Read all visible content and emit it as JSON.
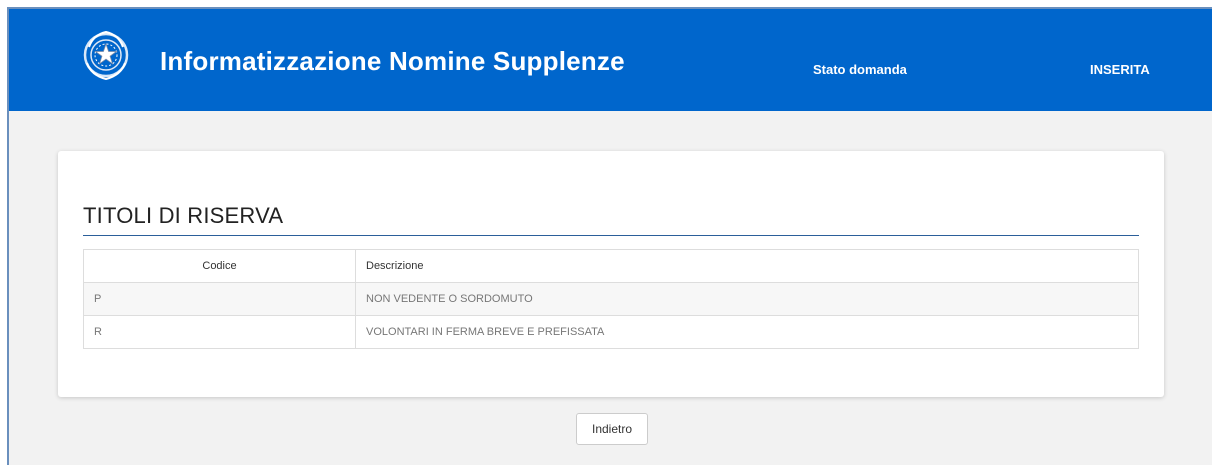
{
  "header": {
    "title": "Informatizzazione Nomine Supplenze",
    "status_label": "Stato domanda",
    "status_value": "INSERITA",
    "logo_icon": "italian-republic-emblem-icon",
    "background_color": "#0066cc"
  },
  "section": {
    "title": "TITOLI DI RISERVA"
  },
  "table": {
    "columns": [
      "Codice",
      "Descrizione"
    ],
    "rows": [
      {
        "codice": "P",
        "descrizione": "NON VEDENTE O SORDOMUTO"
      },
      {
        "codice": "R",
        "descrizione": "VOLONTARI IN FERMA BREVE E PREFISSATA"
      }
    ]
  },
  "actions": {
    "back_label": "Indietro"
  }
}
